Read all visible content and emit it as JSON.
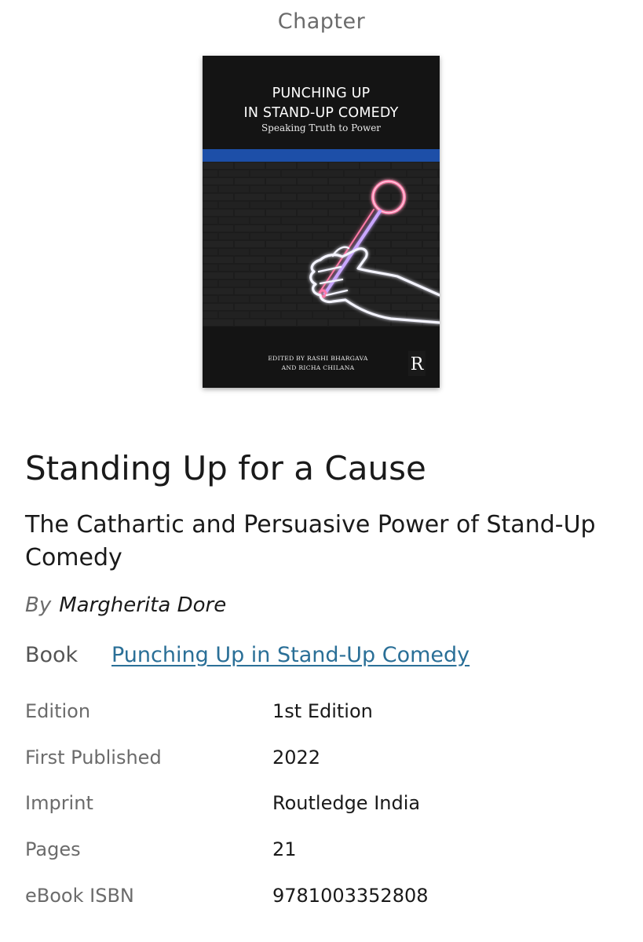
{
  "header": {
    "label": "Chapter"
  },
  "cover": {
    "title_line1": "PUNCHING UP",
    "title_line2": "IN STAND-UP COMEDY",
    "subtitle": "Speaking Truth to Power",
    "editors_line1": "EDITED BY RASHI BHARGAVA",
    "editors_line2": "AND RICHA CHILANA",
    "logo_letter": "R",
    "colors": {
      "background": "#141414",
      "band": "#1d4fa8",
      "neon_hand": "#f4f4ff",
      "neon_mic": "#ff7aa8"
    }
  },
  "chapter": {
    "title": "Standing Up for a Cause",
    "subtitle": "The Cathartic and Persuasive Power of Stand-Up Comedy",
    "by_label": "By",
    "author": "Margherita Dore"
  },
  "book": {
    "label": "Book",
    "link_text": "Punching Up in Stand-Up Comedy"
  },
  "details": [
    {
      "label": "Edition",
      "value": "1st Edition"
    },
    {
      "label": "First Published",
      "value": "2022"
    },
    {
      "label": "Imprint",
      "value": "Routledge India"
    },
    {
      "label": "Pages",
      "value": "21"
    },
    {
      "label": "eBook ISBN",
      "value": "9781003352808"
    }
  ]
}
